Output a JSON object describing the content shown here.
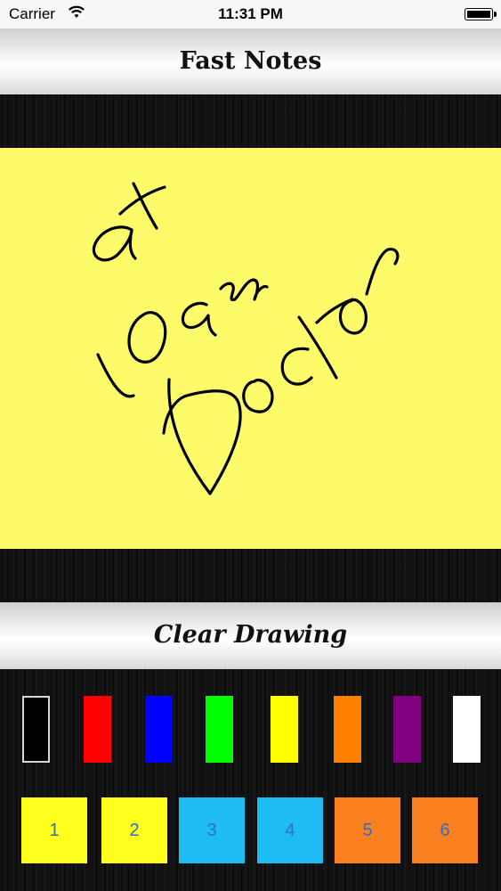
{
  "status_bar": {
    "carrier": "Carrier",
    "time": "11:31 PM"
  },
  "header": {
    "title": "Fast Notes"
  },
  "note": {
    "lines": [
      "at",
      "10 am",
      "Doctor"
    ],
    "background": "#fefb6a",
    "ink": "#000000"
  },
  "clear_button": {
    "label": "Clear Drawing"
  },
  "colors": [
    {
      "name": "black",
      "hex": "#000000"
    },
    {
      "name": "red",
      "hex": "#ff0000"
    },
    {
      "name": "blue",
      "hex": "#0000ff"
    },
    {
      "name": "green",
      "hex": "#00ff00"
    },
    {
      "name": "yellow",
      "hex": "#ffff00"
    },
    {
      "name": "orange",
      "hex": "#ff8000"
    },
    {
      "name": "purple",
      "hex": "#800080"
    },
    {
      "name": "white",
      "hex": "#ffffff"
    }
  ],
  "note_slots": [
    {
      "label": "1",
      "color": "#ffff1e"
    },
    {
      "label": "2",
      "color": "#ffff1e"
    },
    {
      "label": "3",
      "color": "#1ebbf5"
    },
    {
      "label": "4",
      "color": "#1ebbf5"
    },
    {
      "label": "5",
      "color": "#fa8020"
    },
    {
      "label": "6",
      "color": "#fa8020"
    }
  ]
}
